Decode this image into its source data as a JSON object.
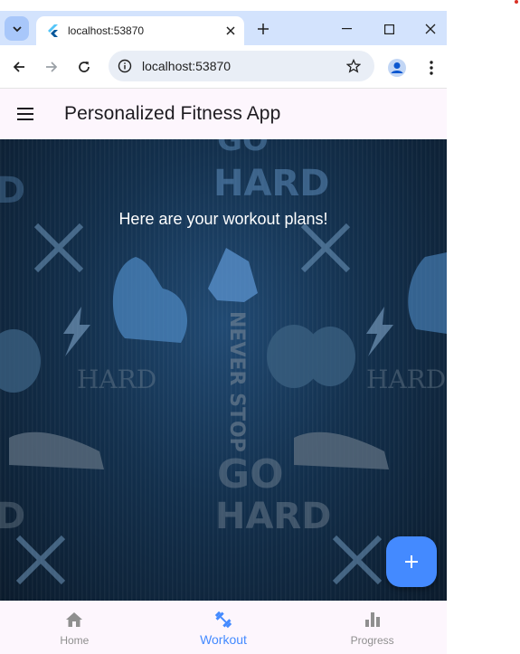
{
  "browser": {
    "tab_title": "localhost:53870",
    "url": "localhost:53870"
  },
  "app": {
    "title": "Personalized Fitness App",
    "headline": "Here are your workout plans!",
    "background_art_text": [
      "GO HARD",
      "HARD",
      "NEVER STOP"
    ]
  },
  "bottom_nav": {
    "items": [
      {
        "label": "Home",
        "icon": "home-icon"
      },
      {
        "label": "Workout",
        "icon": "fitness-icon"
      },
      {
        "label": "Progress",
        "icon": "bar-chart-icon"
      }
    ],
    "active_index": 1
  },
  "colors": {
    "accent": "#448aff",
    "appbar_bg": "#fdf6fd",
    "tabstrip_bg": "#d3e3fd"
  }
}
